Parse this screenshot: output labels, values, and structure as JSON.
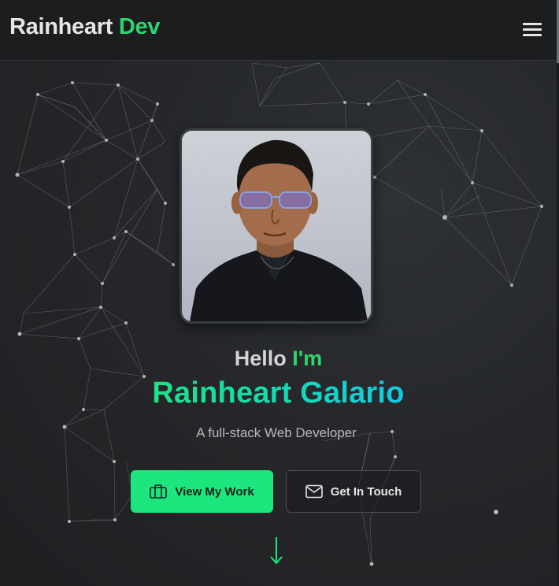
{
  "header": {
    "logo_main": "Rainheart",
    "logo_accent": "Dev",
    "menu_icon": "hamburger-menu-icon"
  },
  "hero": {
    "hello_text": "Hello",
    "hello_accent": "I'm",
    "name": "Rainheart Galario",
    "tagline": "A full-stack Web Developer",
    "primary_button": {
      "label": "View My Work",
      "icon": "briefcase-icon"
    },
    "secondary_button": {
      "label": "Get In Touch",
      "icon": "envelope-icon"
    },
    "scroll_icon": "arrow-down-icon"
  },
  "colors": {
    "accent": "#2bd66f",
    "button_primary": "#1de67f",
    "name_gradient_start": "#1de386",
    "name_gradient_end": "#12c8e6",
    "background": "#222427",
    "header_bg": "#1c1d1f"
  }
}
